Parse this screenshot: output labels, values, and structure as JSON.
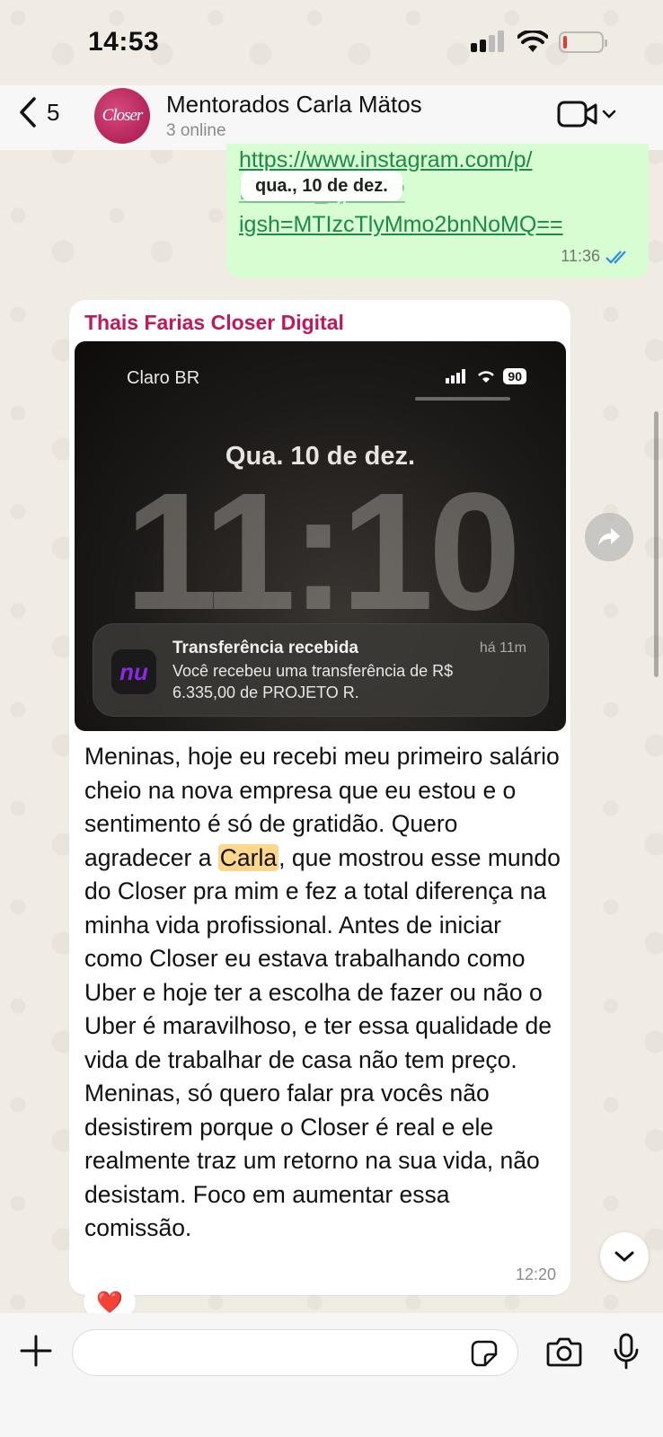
{
  "status_bar": {
    "time": "14:53"
  },
  "header": {
    "back_count": "5",
    "avatar_text": "Closer",
    "group_name": "Mentorados Carla Mätos",
    "online_status": "3 online"
  },
  "outgoing_message": {
    "link_line1": "https://www.instagram.com/p/",
    "link_line2": "DR4Mb_6jdOk/?",
    "link_line3": "igsh=MTIzcTlyMmo2bnNoMQ==",
    "time": "11:36"
  },
  "date_chip": "qua., 10 de dez.",
  "incoming_message": {
    "sender": "Thais Farias Closer Digital",
    "screenshot": {
      "carrier": "Claro BR",
      "battery": "90",
      "date": "Qua. 10 de dez.",
      "time": "11:10",
      "notification": {
        "app_icon_text": "nu",
        "title": "Transferência recebida",
        "time_ago": "há 11m",
        "body": "Você recebeu uma transferência de R$ 6.335,00 de PROJETO R."
      }
    },
    "text_before_mention": "Meninas, hoje eu recebi meu primeiro salário cheio na nova empresa que eu estou e o sentimento é só de gratidão. Quero agradecer a ",
    "mention": "Carla",
    "text_after_mention": ", que mostrou esse mundo do Closer pra mim e fez a total diferença na minha vida profissional. Antes de iniciar como Closer eu estava trabalhando como Uber e hoje ter a escolha de fazer ou não o Uber é maravilhoso, e ter essa qualidade de vida de trabalhar de casa não tem preço. Meninas, só quero falar pra vocês não desistirem porque o Closer é real e ele realmente traz um retorno na sua vida, não desistam. Foco em aumentar essa comissão.",
    "time": "12:20",
    "reaction": "❤️"
  },
  "composer": {
    "placeholder": ""
  },
  "colors": {
    "outgoing_bubble": "#d9fdd3",
    "sender_name": "#c2185b",
    "link": "#1c8a4a",
    "read_ticks": "#2f8ae6",
    "mention_highlight": "#ffd68a"
  }
}
